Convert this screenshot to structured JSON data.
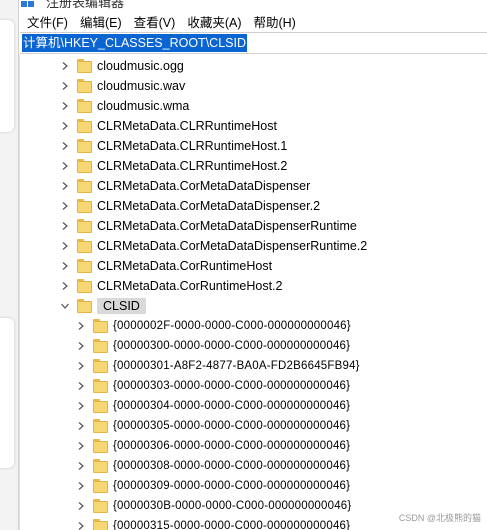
{
  "window": {
    "title": "注册表编辑器"
  },
  "menubar": {
    "items": [
      "文件(F)",
      "编辑(E)",
      "查看(V)",
      "收藏夹(A)",
      "帮助(H)"
    ]
  },
  "address": {
    "path": "计算机\\HKEY_CLASSES_ROOT\\CLSID"
  },
  "tree": {
    "top_nodes": [
      "cloudmusic.ogg",
      "cloudmusic.wav",
      "cloudmusic.wma",
      "CLRMetaData.CLRRuntimeHost",
      "CLRMetaData.CLRRuntimeHost.1",
      "CLRMetaData.CLRRuntimeHost.2",
      "CLRMetaData.CorMetaDataDispenser",
      "CLRMetaData.CorMetaDataDispenser.2",
      "CLRMetaData.CorMetaDataDispenserRuntime",
      "CLRMetaData.CorMetaDataDispenserRuntime.2",
      "CLRMetaData.CorRuntimeHost",
      "CLRMetaData.CorRuntimeHost.2"
    ],
    "selected_node": "CLSID",
    "child_nodes": [
      "{0000002F-0000-0000-C000-000000000046}",
      "{00000300-0000-0000-C000-000000000046}",
      "{00000301-A8F2-4877-BA0A-FD2B6645FB94}",
      "{00000303-0000-0000-C000-000000000046}",
      "{00000304-0000-0000-C000-000000000046}",
      "{00000305-0000-0000-C000-000000000046}",
      "{00000306-0000-0000-C000-000000000046}",
      "{00000308-0000-0000-C000-000000000046}",
      "{00000309-0000-0000-C000-000000000046}",
      "{0000030B-0000-0000-C000-000000000046}",
      "{00000315-0000-0000-C000-000000000046}"
    ]
  },
  "watermark": "CSDN @北极熊的猫",
  "colors": {
    "address_highlight": "#0a64d2",
    "folder_fill": "#f7d774",
    "folder_border": "#e3b441",
    "selected_bg": "#d9d9d9"
  },
  "icons": {
    "collapsed": "chevron-right-icon",
    "expanded": "chevron-down-icon",
    "folder": "folder-icon",
    "app": "regedit-icon"
  }
}
